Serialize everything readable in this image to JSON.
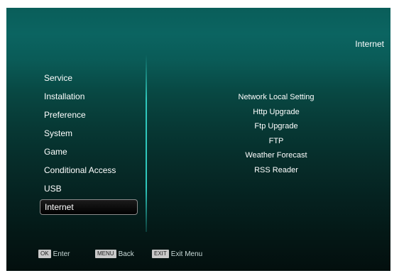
{
  "header": {
    "title": "Internet"
  },
  "menu": {
    "items": [
      {
        "label": "Service"
      },
      {
        "label": "Installation"
      },
      {
        "label": "Preference"
      },
      {
        "label": "System"
      },
      {
        "label": "Game"
      },
      {
        "label": "Conditional Access"
      },
      {
        "label": "USB"
      },
      {
        "label": "Internet"
      }
    ],
    "selected": "Internet"
  },
  "submenu": {
    "items": [
      {
        "label": "Network Local Setting"
      },
      {
        "label": "Http Upgrade"
      },
      {
        "label": "Ftp Upgrade"
      },
      {
        "label": "FTP"
      },
      {
        "label": "Weather Forecast"
      },
      {
        "label": "RSS Reader"
      }
    ]
  },
  "footer": {
    "ok": {
      "key": "OK",
      "label": "Enter"
    },
    "menu": {
      "key": "MENU",
      "label": "Back"
    },
    "exit": {
      "key": "EXIT",
      "label": "Exit Menu"
    }
  }
}
